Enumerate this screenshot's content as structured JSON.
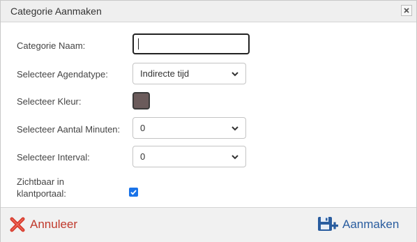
{
  "dialog": {
    "title": "Categorie Aanmaken"
  },
  "form": {
    "name_label": "Categorie Naam:",
    "name_value": "",
    "agendatype_label": "Selecteer Agendatype:",
    "agendatype_value": "Indirecte tijd",
    "color_label": "Selecteer Kleur:",
    "color_value": "#6b5b5b",
    "minutes_label": "Selecteer Aantal Minuten:",
    "minutes_value": "0",
    "interval_label": "Selecteer Interval:",
    "interval_value": "0",
    "visible_label_line1": "Zichtbaar in",
    "visible_label_line2": "klantportaal:",
    "visible_checked": true
  },
  "footer": {
    "cancel_label": "Annuleer",
    "create_label": "Aanmaken"
  },
  "icons": {
    "close": "close-icon",
    "cancel": "red-x-icon",
    "create": "save-plus-icon",
    "dropdown": "chevron-down-icon"
  },
  "colors": {
    "accent_blue": "#2a5d9f",
    "danger_red": "#c0392b",
    "checkbox_blue": "#1a73e8"
  }
}
